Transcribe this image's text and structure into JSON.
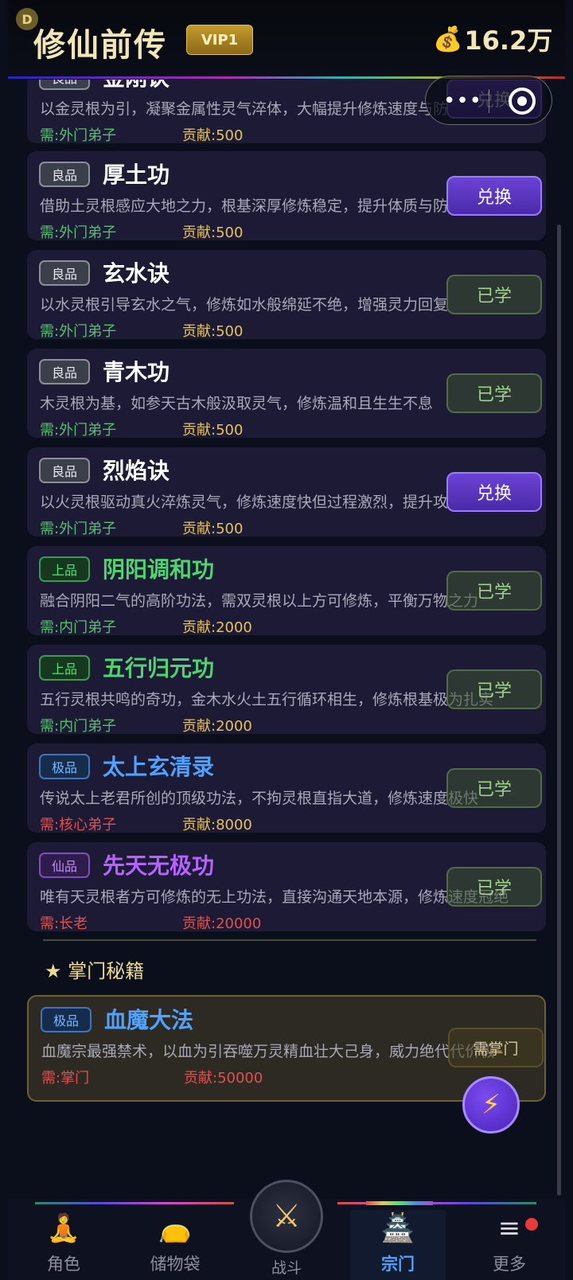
{
  "header": {
    "corner_badge": "D",
    "title": "修仙前传",
    "vip": "VIP1",
    "money_icon": "money-bag-icon",
    "money": "16.2万"
  },
  "capsule": {
    "more_icon": "•••",
    "target_icon": "target-icon"
  },
  "cards": [
    {
      "grade": "良品",
      "name": "金刚诀",
      "desc": "以金灵根为引，凝聚金属性灵气淬体，大幅提升修炼速度与防御",
      "req": "需:外门弟子",
      "contrib": "贡献:500",
      "button": "兑换"
    },
    {
      "grade": "良品",
      "name": "厚土功",
      "desc": "借助土灵根感应大地之力，根基深厚修炼稳定，提升体质与防御",
      "req": "需:外门弟子",
      "contrib": "贡献:500",
      "button": "兑换"
    },
    {
      "grade": "良品",
      "name": "玄水诀",
      "desc": "以水灵根引导玄水之气，修炼如水般绵延不绝，增强灵力回复",
      "req": "需:外门弟子",
      "contrib": "贡献:500",
      "button": "已学"
    },
    {
      "grade": "良品",
      "name": "青木功",
      "desc": "木灵根为基，如参天古木般汲取灵气，修炼温和且生生不息",
      "req": "需:外门弟子",
      "contrib": "贡献:500",
      "button": "已学"
    },
    {
      "grade": "良品",
      "name": "烈焰诀",
      "desc": "以火灵根驱动真火淬炼灵气，修炼速度快但过程激烈，提升攻击力",
      "req": "需:外门弟子",
      "contrib": "贡献:500",
      "button": "兑换"
    },
    {
      "grade": "上品",
      "name": "阴阳调和功",
      "desc": "融合阴阳二气的高阶功法，需双灵根以上方可修炼，平衡万物之力",
      "req": "需:内门弟子",
      "contrib": "贡献:2000",
      "button": "已学"
    },
    {
      "grade": "上品",
      "name": "五行归元功",
      "desc": "五行灵根共鸣的奇功，金木水火土五行循环相生，修炼根基极为扎实",
      "req": "需:内门弟子",
      "contrib": "贡献:2000",
      "button": "已学"
    },
    {
      "grade": "极品",
      "name": "太上玄清录",
      "desc": "传说太上老君所创的顶级功法，不拘灵根直指大道，修炼速度极快",
      "req": "需:核心弟子",
      "contrib": "贡献:8000",
      "button": "已学"
    },
    {
      "grade": "仙品",
      "name": "先天无极功",
      "desc": "唯有天灵根者方可修炼的无上功法，直接沟通天地本源，修炼速度冠绝",
      "req": "需:长老",
      "contrib": "贡献:20000",
      "button": "已学"
    }
  ],
  "section_title": "★ 掌门秘籍",
  "master_card": {
    "grade": "极品",
    "name": "血魔大法",
    "desc": "血魔宗最强禁术，以血为引吞噬万灵精血壮大己身，威力绝代代价极",
    "req": "需:掌门",
    "contrib": "贡献:50000",
    "button": "需掌门"
  },
  "fab_icon": "lightning-icon",
  "nav": {
    "items": [
      {
        "label": "角色",
        "icon": "meditation-icon"
      },
      {
        "label": "储物袋",
        "icon": "bag-icon"
      },
      {
        "label": "战斗",
        "icon": "crossed-swords-icon"
      },
      {
        "label": "宗门",
        "icon": "pavilion-icon"
      },
      {
        "label": "更多",
        "icon": "menu-icon"
      }
    ]
  }
}
